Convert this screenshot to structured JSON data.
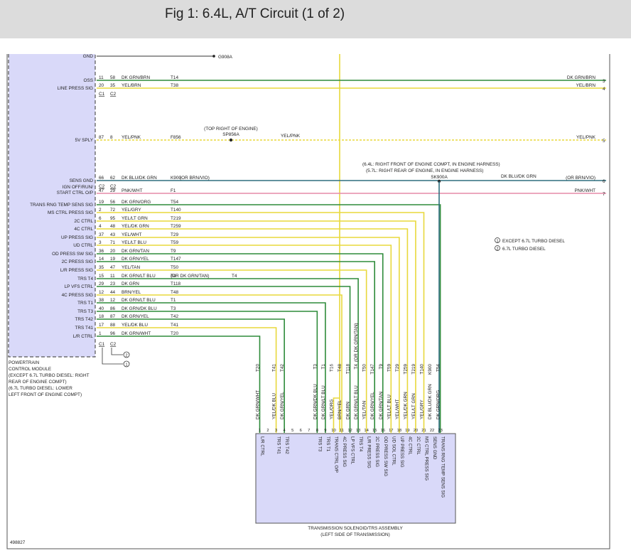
{
  "header": {
    "title": "Fig 1: 6.4L, A/T Circuit (1 of 2)"
  },
  "colors": {
    "dk_grn": "#2e8b3a",
    "yel": "#e8d83c",
    "pink": "#e58aa8",
    "dk_blu": "#2f6f7f",
    "pcm_fill": "#d9d9f9",
    "tsa_fill": "#d9d9f9"
  },
  "pcm": {
    "name": "POWERTRAIN CONTROL MODULE",
    "note_lines": [
      "POWERTRAIN",
      "CONTROL MODULE",
      "(EXCEPT 6.7L TURBO DIESEL: RIGHT",
      "REAR OF ENGINE COMPT)",
      "(6.7L TURBO DIESEL: LOWER",
      "LEFT FRONT OF ENGINE COMPT)"
    ],
    "conn_c1": "C1",
    "conn_c2": "C2",
    "circle1": "1",
    "circle2": "2"
  },
  "top": {
    "gnd_label": "GND",
    "gnd_splice": "G908A",
    "conn_c1": "C1",
    "conn_c2": "C2"
  },
  "splices": {
    "sp856a_loc": "(TOP RIGHT OF ENGINE)",
    "sp856a": "SP856A",
    "sk900a_loc1": "(6.4L: RIGHT FRONT OF ENGINE COMPT, IN ENGINE HARNESS)",
    "sk900a_loc2": "(5.7L: RIGHT REAR OF ENGINE, IN ENGINE HARNESS)",
    "sk900a": "SK900A",
    "sens_gnd_conn_c2a": "C2",
    "sens_gnd_conn_c2b": "C2"
  },
  "legend": {
    "item1_num": "1",
    "item1": "EXCEPT 6.7L TURBO DIESEL",
    "item2_num": "2",
    "item2": "6.7L TURBO DIESEL"
  },
  "rows": [
    {
      "label": "OSS",
      "p1": "11",
      "p2": "58",
      "color": "DK GRN/BRN",
      "ckt": "T14",
      "right_color": "DK GRN/BRN",
      "right_pin": "3"
    },
    {
      "label": "LINE PRESS SIG",
      "p1": "20",
      "p2": "35",
      "color": "YEL/BRN",
      "ckt": "T38",
      "right_color": "YEL/BRN",
      "right_pin": "4"
    },
    {
      "label": "5V SPLY",
      "p1": "87",
      "p2": "8",
      "color": "YEL/PNK",
      "ckt": "F856",
      "mid_color": "YEL/PNK",
      "right_color": "YEL/PNK",
      "right_pin": "5"
    },
    {
      "label": "SENS GND",
      "p1": "66",
      "p2": "62",
      "color": "DK BLU/DK GRN",
      "alt": "(OR BRN/VIO)",
      "ckt": "K900",
      "mid_color": "DK BLU/DK GRN",
      "right_color": "(OR BRN/VIO)",
      "right_pin": "6"
    },
    {
      "label": "IGN OFF/RUN/ START CTRL O/P",
      "label1": "IGN OFF/RUN/",
      "label2": "START CTRL O/P",
      "p1": "47",
      "p2": "29",
      "color": "PNK/WHT",
      "ckt": "F1",
      "right_color": "PNK/WHT",
      "right_pin": "7"
    },
    {
      "label": "TRANS RNG TEMP SENS SIG",
      "p1": "19",
      "p2": "56",
      "color": "DK GRN/ORG",
      "ckt": "T54"
    },
    {
      "label": "MS CTRL PRESS SIG",
      "p1": "2",
      "p2": "72",
      "color": "YEL/GRY",
      "ckt": "T140"
    },
    {
      "label": "2C CTRL",
      "p1": "6",
      "p2": "95",
      "color": "YEL/LT GRN",
      "ckt": "T219"
    },
    {
      "label": "4C CTRL",
      "p1": "4",
      "p2": "48",
      "color": "YEL/DK GRN",
      "ckt": "T259"
    },
    {
      "label": "UP PRESS SIG",
      "p1": "37",
      "p2": "43",
      "color": "YEL/WHT",
      "ckt": "T29"
    },
    {
      "label": "UD CTRL",
      "p1": "3",
      "p2": "71",
      "color": "YEL/LT BLU",
      "ckt": "T59"
    },
    {
      "label": "OD PRESS SW SIG",
      "p1": "36",
      "p2": "20",
      "color": "DK GRN/TAN",
      "ckt": "T9"
    },
    {
      "label": "2C PRESS SIG",
      "p1": "14",
      "p2": "19",
      "color": "DK GRN/YEL",
      "ckt": "T147"
    },
    {
      "label": "L/R PRESS SIG",
      "p1": "35",
      "p2": "47",
      "color": "YEL/TAN",
      "ckt": "T50"
    },
    {
      "label": "TRS T4",
      "p1": "15",
      "p2": "11",
      "color": "DK GRN/LT BLU",
      "alt": "(OR DK GRN/TAN)",
      "ckt": "T4"
    },
    {
      "label": "LP VFS CTRL",
      "p1": "29",
      "p2": "23",
      "color": "DK GRN",
      "ckt": "T118"
    },
    {
      "label": "4C PRESS SIG",
      "p1": "12",
      "p2": "44",
      "color": "BRN/YEL",
      "ckt": "T48"
    },
    {
      "label": "TRS T1",
      "p1": "38",
      "p2": "12",
      "color": "DK GRN/LT BLU",
      "ckt": "T1"
    },
    {
      "label": "TRS T3",
      "p1": "40",
      "p2": "86",
      "color": "DK GRN/DK BLU",
      "ckt": "T3"
    },
    {
      "label": "TRS T42",
      "p1": "18",
      "p2": "87",
      "color": "DK GRN/YEL",
      "ckt": "T42"
    },
    {
      "label": "TRS T41",
      "p1": "17",
      "p2": "88",
      "color": "YEL/DK BLU",
      "ckt": "T41"
    },
    {
      "label": "L/R CTRL",
      "p1": "1",
      "p2": "96",
      "color": "DK GRN/WHT",
      "ckt": "T20"
    }
  ],
  "drops": [
    {
      "ckt": "T20",
      "color": "DK GRN/WHT",
      "pin": "1"
    },
    {
      "ckt": "",
      "color": "",
      "pin": "2"
    },
    {
      "ckt": "T41",
      "color": "YEL/DK BLU",
      "pin": "3"
    },
    {
      "ckt": "T42",
      "color": "DK GRN/YEL",
      "pin": "4"
    },
    {
      "ckt": "",
      "color": "",
      "pin": "5"
    },
    {
      "ckt": "",
      "color": "",
      "pin": "6"
    },
    {
      "ckt": "",
      "color": "",
      "pin": "7"
    },
    {
      "ckt": "T3",
      "color": "DK GRN/DK BLU",
      "pin": "8"
    },
    {
      "ckt": "T1",
      "color": "DK GRN/LT BLU",
      "pin": "9"
    },
    {
      "ckt": "T16",
      "color": "YEL/ORG",
      "pin": "10"
    },
    {
      "ckt": "T48",
      "color": "BRN/YEL",
      "pin": "11"
    },
    {
      "ckt": "T118",
      "color": "DK GRN",
      "pin": "12"
    },
    {
      "ckt": "T4",
      "color": "DK GRN/LT BLU",
      "alt": "(OR DK GRN/TAN)",
      "pin": "13"
    },
    {
      "ckt": "T50",
      "color": "YEL/TAN",
      "pin": "14"
    },
    {
      "ckt": "T147",
      "color": "DK GRN/YEL",
      "pin": "15"
    },
    {
      "ckt": "T9",
      "color": "DK GRN/TAN",
      "pin": "16"
    },
    {
      "ckt": "T59",
      "color": "YEL/LT BLU",
      "pin": "17"
    },
    {
      "ckt": "T29",
      "color": "YEL/WHT",
      "pin": "18"
    },
    {
      "ckt": "T259",
      "color": "YEL/DK GRN",
      "pin": "19"
    },
    {
      "ckt": "T219",
      "color": "YEL/LT GRN",
      "pin": "20"
    },
    {
      "ckt": "T140",
      "color": "YEL/GRY",
      "pin": "21"
    },
    {
      "ckt": "K900",
      "color": "DK BLU/DK GRN",
      "pin": "22"
    },
    {
      "ckt": "T54",
      "color": "DK GRN/ORG",
      "pin": "23"
    }
  ],
  "tsa": {
    "pins": [
      "L/R CTRL",
      "",
      "TRS T41",
      "TRS T42",
      "",
      "",
      "",
      "TRS T3",
      "TRS T1",
      "TRANS CTRL O/P",
      "4C PRESS SIG",
      "LP VFS CTRL",
      "TRS T4",
      "L/R PRESS SIG",
      "2C PRESS SIG",
      "OD PRESS SW SIG",
      "UD SOL CTRL",
      "UP PRESS SIG",
      "4C CTRL",
      "2C CTRL",
      "MS CTRL PRESS SIG",
      "SENS GND",
      "TRANS RNG TEMP SENS SIG"
    ],
    "name1": "TRANSMISSION SOLENOID/TRS ASSEMBLY",
    "name2": "(LEFT SIDE OF TRANSMISSION)"
  },
  "figure_id": "498827"
}
